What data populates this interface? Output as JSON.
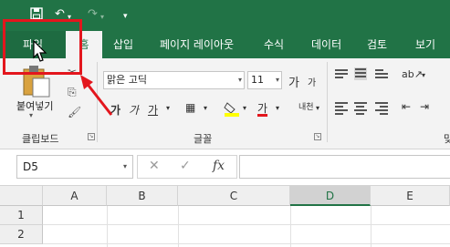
{
  "qat": {
    "save_icon": "save-icon",
    "undo_icon": "undo-icon",
    "redo_icon": "redo-icon",
    "customize_icon": "customize-icon"
  },
  "tabs": [
    {
      "label": "파일"
    },
    {
      "label": "홈"
    },
    {
      "label": "삽입"
    },
    {
      "label": "페이지 레이아웃"
    },
    {
      "label": "수식"
    },
    {
      "label": "데이터"
    },
    {
      "label": "검토"
    },
    {
      "label": "보기"
    }
  ],
  "clipboard": {
    "paste_label": "붙여넣기",
    "group_label": "클립보드"
  },
  "font": {
    "name": "맑은 고딕",
    "size": "11",
    "group_label": "글꼴",
    "grow": "가",
    "shrink": "가",
    "bold": "가",
    "italic": "가",
    "underline": "가",
    "font_color_glyph": "가",
    "phonetic": "내천"
  },
  "alignment": {
    "group_label_partial": "맞"
  },
  "formula_bar": {
    "name_box": "D5",
    "fx": "fx",
    "cancel": "✕",
    "enter": "✓"
  },
  "grid": {
    "columns": [
      "A",
      "B",
      "C",
      "D",
      "E"
    ],
    "selected_column": "D",
    "rows": [
      "1",
      "2"
    ]
  },
  "colors": {
    "excel_green": "#217346",
    "highlight_red": "#e3161d"
  }
}
